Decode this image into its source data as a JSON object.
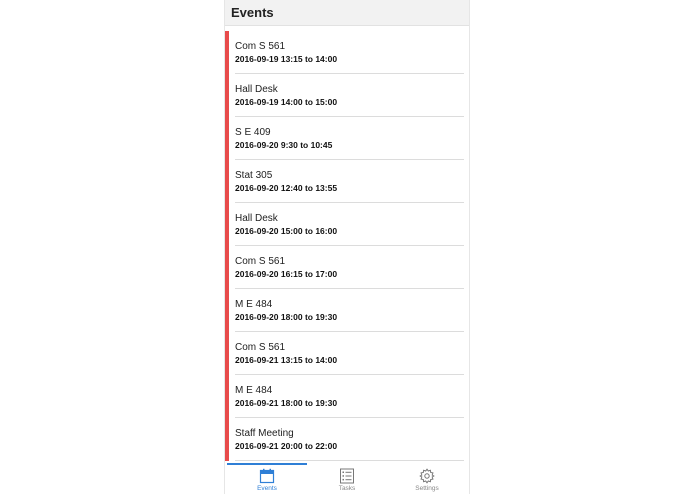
{
  "header": {
    "title": "Events"
  },
  "events": [
    {
      "name": "Com S 561",
      "time": "2016-09-19 13:15 to 14:00"
    },
    {
      "name": "Hall Desk",
      "time": "2016-09-19 14:00 to 15:00"
    },
    {
      "name": "S E 409",
      "time": "2016-09-20 9:30 to 10:45"
    },
    {
      "name": "Stat 305",
      "time": "2016-09-20 12:40 to 13:55"
    },
    {
      "name": "Hall Desk",
      "time": "2016-09-20 15:00 to 16:00"
    },
    {
      "name": "Com S 561",
      "time": "2016-09-20 16:15 to 17:00"
    },
    {
      "name": "M E 484",
      "time": "2016-09-20 18:00 to 19:30"
    },
    {
      "name": "Com S 561",
      "time": "2016-09-21 13:15 to 14:00"
    },
    {
      "name": "M E 484",
      "time": "2016-09-21 18:00 to 19:30"
    },
    {
      "name": "Staff Meeting",
      "time": "2016-09-21 20:00 to 22:00"
    }
  ],
  "tabs": [
    {
      "label": "Events",
      "icon": "calendar-icon",
      "active": true
    },
    {
      "label": "Tasks",
      "icon": "list-icon",
      "active": false
    },
    {
      "label": "Settings",
      "icon": "gear-icon",
      "active": false
    }
  ],
  "colors": {
    "event_accent": "#e84b4b",
    "active_tab": "#2f7fd6",
    "inactive_tab": "#888888"
  }
}
